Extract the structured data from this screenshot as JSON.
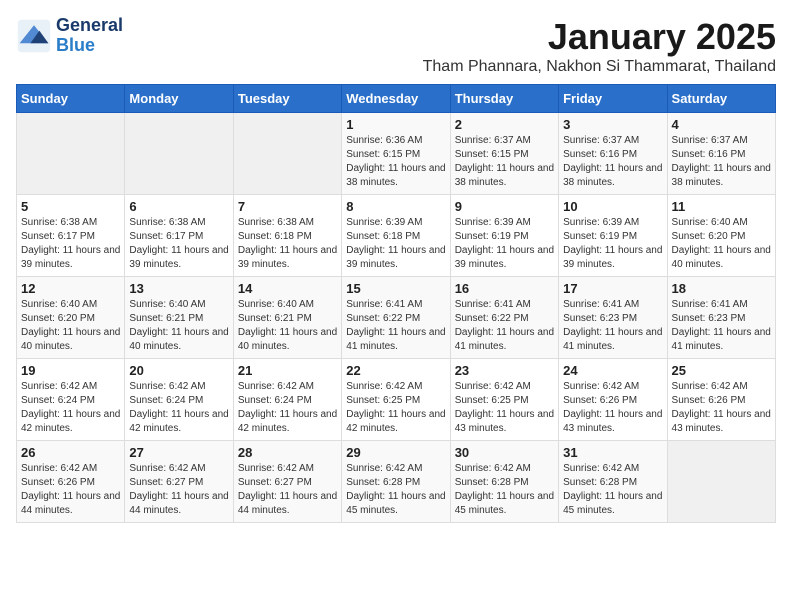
{
  "logo": {
    "line1": "General",
    "line2": "Blue"
  },
  "title": "January 2025",
  "location": "Tham Phannara, Nakhon Si Thammarat, Thailand",
  "days_of_week": [
    "Sunday",
    "Monday",
    "Tuesday",
    "Wednesday",
    "Thursday",
    "Friday",
    "Saturday"
  ],
  "weeks": [
    [
      {
        "day": "",
        "info": ""
      },
      {
        "day": "",
        "info": ""
      },
      {
        "day": "",
        "info": ""
      },
      {
        "day": "1",
        "info": "Sunrise: 6:36 AM\nSunset: 6:15 PM\nDaylight: 11 hours and 38 minutes."
      },
      {
        "day": "2",
        "info": "Sunrise: 6:37 AM\nSunset: 6:15 PM\nDaylight: 11 hours and 38 minutes."
      },
      {
        "day": "3",
        "info": "Sunrise: 6:37 AM\nSunset: 6:16 PM\nDaylight: 11 hours and 38 minutes."
      },
      {
        "day": "4",
        "info": "Sunrise: 6:37 AM\nSunset: 6:16 PM\nDaylight: 11 hours and 38 minutes."
      }
    ],
    [
      {
        "day": "5",
        "info": "Sunrise: 6:38 AM\nSunset: 6:17 PM\nDaylight: 11 hours and 39 minutes."
      },
      {
        "day": "6",
        "info": "Sunrise: 6:38 AM\nSunset: 6:17 PM\nDaylight: 11 hours and 39 minutes."
      },
      {
        "day": "7",
        "info": "Sunrise: 6:38 AM\nSunset: 6:18 PM\nDaylight: 11 hours and 39 minutes."
      },
      {
        "day": "8",
        "info": "Sunrise: 6:39 AM\nSunset: 6:18 PM\nDaylight: 11 hours and 39 minutes."
      },
      {
        "day": "9",
        "info": "Sunrise: 6:39 AM\nSunset: 6:19 PM\nDaylight: 11 hours and 39 minutes."
      },
      {
        "day": "10",
        "info": "Sunrise: 6:39 AM\nSunset: 6:19 PM\nDaylight: 11 hours and 39 minutes."
      },
      {
        "day": "11",
        "info": "Sunrise: 6:40 AM\nSunset: 6:20 PM\nDaylight: 11 hours and 40 minutes."
      }
    ],
    [
      {
        "day": "12",
        "info": "Sunrise: 6:40 AM\nSunset: 6:20 PM\nDaylight: 11 hours and 40 minutes."
      },
      {
        "day": "13",
        "info": "Sunrise: 6:40 AM\nSunset: 6:21 PM\nDaylight: 11 hours and 40 minutes."
      },
      {
        "day": "14",
        "info": "Sunrise: 6:40 AM\nSunset: 6:21 PM\nDaylight: 11 hours and 40 minutes."
      },
      {
        "day": "15",
        "info": "Sunrise: 6:41 AM\nSunset: 6:22 PM\nDaylight: 11 hours and 41 minutes."
      },
      {
        "day": "16",
        "info": "Sunrise: 6:41 AM\nSunset: 6:22 PM\nDaylight: 11 hours and 41 minutes."
      },
      {
        "day": "17",
        "info": "Sunrise: 6:41 AM\nSunset: 6:23 PM\nDaylight: 11 hours and 41 minutes."
      },
      {
        "day": "18",
        "info": "Sunrise: 6:41 AM\nSunset: 6:23 PM\nDaylight: 11 hours and 41 minutes."
      }
    ],
    [
      {
        "day": "19",
        "info": "Sunrise: 6:42 AM\nSunset: 6:24 PM\nDaylight: 11 hours and 42 minutes."
      },
      {
        "day": "20",
        "info": "Sunrise: 6:42 AM\nSunset: 6:24 PM\nDaylight: 11 hours and 42 minutes."
      },
      {
        "day": "21",
        "info": "Sunrise: 6:42 AM\nSunset: 6:24 PM\nDaylight: 11 hours and 42 minutes."
      },
      {
        "day": "22",
        "info": "Sunrise: 6:42 AM\nSunset: 6:25 PM\nDaylight: 11 hours and 42 minutes."
      },
      {
        "day": "23",
        "info": "Sunrise: 6:42 AM\nSunset: 6:25 PM\nDaylight: 11 hours and 43 minutes."
      },
      {
        "day": "24",
        "info": "Sunrise: 6:42 AM\nSunset: 6:26 PM\nDaylight: 11 hours and 43 minutes."
      },
      {
        "day": "25",
        "info": "Sunrise: 6:42 AM\nSunset: 6:26 PM\nDaylight: 11 hours and 43 minutes."
      }
    ],
    [
      {
        "day": "26",
        "info": "Sunrise: 6:42 AM\nSunset: 6:26 PM\nDaylight: 11 hours and 44 minutes."
      },
      {
        "day": "27",
        "info": "Sunrise: 6:42 AM\nSunset: 6:27 PM\nDaylight: 11 hours and 44 minutes."
      },
      {
        "day": "28",
        "info": "Sunrise: 6:42 AM\nSunset: 6:27 PM\nDaylight: 11 hours and 44 minutes."
      },
      {
        "day": "29",
        "info": "Sunrise: 6:42 AM\nSunset: 6:28 PM\nDaylight: 11 hours and 45 minutes."
      },
      {
        "day": "30",
        "info": "Sunrise: 6:42 AM\nSunset: 6:28 PM\nDaylight: 11 hours and 45 minutes."
      },
      {
        "day": "31",
        "info": "Sunrise: 6:42 AM\nSunset: 6:28 PM\nDaylight: 11 hours and 45 minutes."
      },
      {
        "day": "",
        "info": ""
      }
    ]
  ]
}
